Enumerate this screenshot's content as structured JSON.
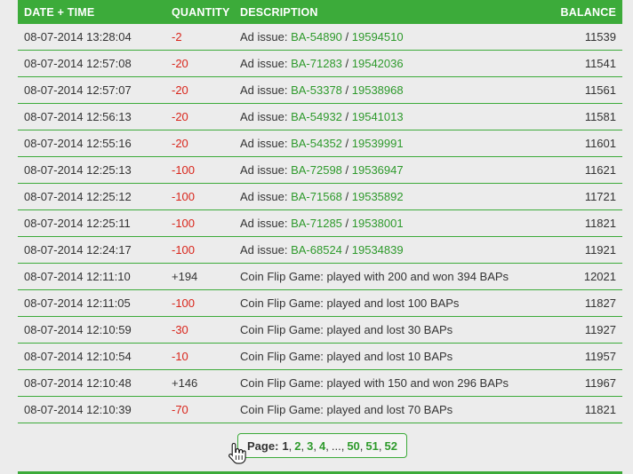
{
  "headers": {
    "date": "DATE + TIME",
    "quantity": "QUANTITY",
    "description": "DESCRIPTION",
    "balance": "BALANCE"
  },
  "colors": {
    "accent": "#3cab3a",
    "negative": "#d9261c",
    "link": "#2e9a2c"
  },
  "rows": [
    {
      "date": "08-07-2014 13:28:04",
      "qty": "-2",
      "desc": "Ad issue: ",
      "link1": "BA-54890",
      "slash": " / ",
      "link2": "19594510",
      "bal": "11539"
    },
    {
      "date": "08-07-2014 12:57:08",
      "qty": "-20",
      "desc": "Ad issue: ",
      "link1": "BA-71283",
      "slash": " / ",
      "link2": "19542036",
      "bal": "11541"
    },
    {
      "date": "08-07-2014 12:57:07",
      "qty": "-20",
      "desc": "Ad issue: ",
      "link1": "BA-53378",
      "slash": " / ",
      "link2": "19538968",
      "bal": "11561"
    },
    {
      "date": "08-07-2014 12:56:13",
      "qty": "-20",
      "desc": "Ad issue: ",
      "link1": "BA-54932",
      "slash": " / ",
      "link2": "19541013",
      "bal": "11581"
    },
    {
      "date": "08-07-2014 12:55:16",
      "qty": "-20",
      "desc": "Ad issue: ",
      "link1": "BA-54352",
      "slash": " / ",
      "link2": "19539991",
      "bal": "11601"
    },
    {
      "date": "08-07-2014 12:25:13",
      "qty": "-100",
      "desc": "Ad issue: ",
      "link1": "BA-72598",
      "slash": " / ",
      "link2": "19536947",
      "bal": "11621"
    },
    {
      "date": "08-07-2014 12:25:12",
      "qty": "-100",
      "desc": "Ad issue: ",
      "link1": "BA-71568",
      "slash": " / ",
      "link2": "19535892",
      "bal": "11721"
    },
    {
      "date": "08-07-2014 12:25:11",
      "qty": "-100",
      "desc": "Ad issue: ",
      "link1": "BA-71285",
      "slash": " / ",
      "link2": "19538001",
      "bal": "11821"
    },
    {
      "date": "08-07-2014 12:24:17",
      "qty": "-100",
      "desc": "Ad issue: ",
      "link1": "BA-68524",
      "slash": " / ",
      "link2": "19534839",
      "bal": "11921"
    },
    {
      "date": "08-07-2014 12:11:10",
      "qty": "+194",
      "desc": "Coin Flip Game: played with 200 and won 394 BAPs",
      "bal": "12021"
    },
    {
      "date": "08-07-2014 12:11:05",
      "qty": "-100",
      "desc": "Coin Flip Game: played and lost 100 BAPs",
      "bal": "11827"
    },
    {
      "date": "08-07-2014 12:10:59",
      "qty": "-30",
      "desc": "Coin Flip Game: played and lost 30 BAPs",
      "bal": "11927"
    },
    {
      "date": "08-07-2014 12:10:54",
      "qty": "-10",
      "desc": "Coin Flip Game: played and lost 10 BAPs",
      "bal": "11957"
    },
    {
      "date": "08-07-2014 12:10:48",
      "qty": "+146",
      "desc": "Coin Flip Game: played with 150 and won 296 BAPs",
      "bal": "11967"
    },
    {
      "date": "08-07-2014 12:10:39",
      "qty": "-70",
      "desc": "Coin Flip Game: played and lost 70 BAPs",
      "bal": "11821"
    }
  ],
  "pagination": {
    "label": "Page:",
    "pages": [
      {
        "text": "1",
        "current": true
      },
      {
        "text": "2",
        "current": false
      },
      {
        "text": "3",
        "current": false
      },
      {
        "text": "4",
        "current": false
      },
      {
        "text": "...",
        "current": true,
        "ellipsis": true
      },
      {
        "text": "50",
        "current": false
      },
      {
        "text": "51",
        "current": false
      },
      {
        "text": "52",
        "current": false
      }
    ]
  },
  "icons": {
    "cursor": "hand-pointer-icon"
  }
}
